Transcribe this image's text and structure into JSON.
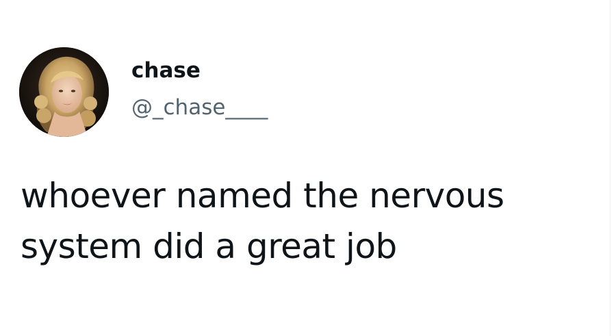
{
  "tweet": {
    "author": {
      "display_name": "chase",
      "handle": "@_chase____",
      "avatar": "profile-photo"
    },
    "text": "whoever named the nervous system did a great job"
  }
}
